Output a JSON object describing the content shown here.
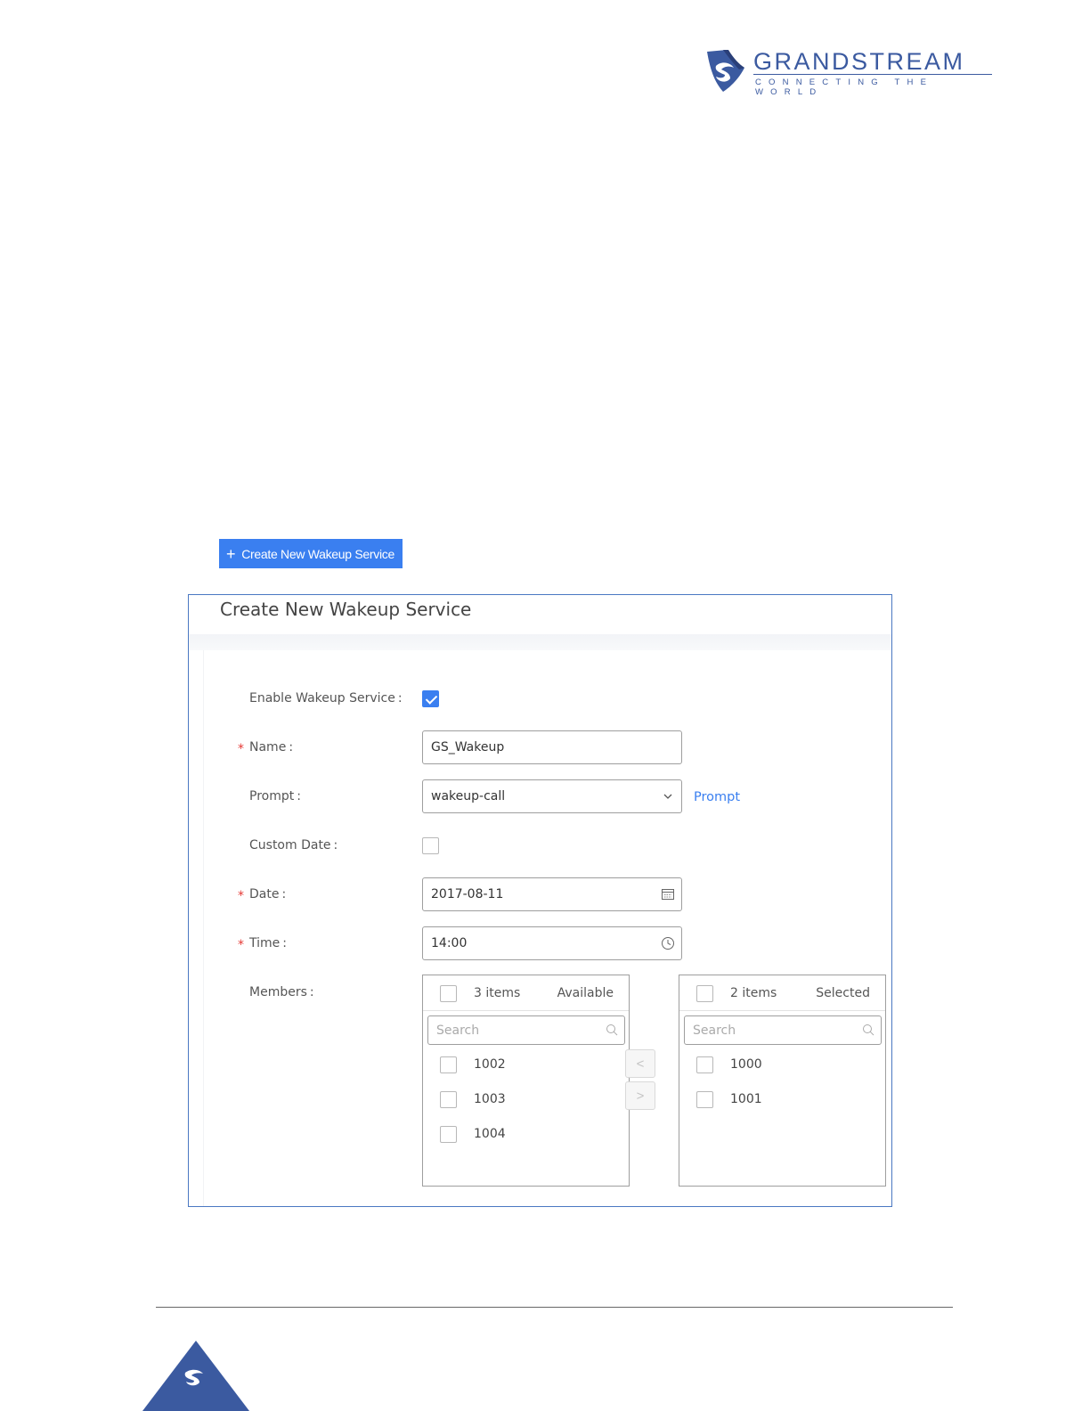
{
  "header": {
    "brand": "GRANDSTREAM",
    "tagline": "CONNECTING THE WORLD",
    "brand_color": "#3b5aa0"
  },
  "create_button": {
    "label": "Create New Wakeup Service",
    "icon": "plus-icon",
    "color": "#3a7ff0"
  },
  "dialog": {
    "title": "Create New Wakeup Service",
    "fields": {
      "enable": {
        "label": "Enable Wakeup Service",
        "checked": true
      },
      "name": {
        "label": "Name",
        "value": "GS_Wakeup",
        "required": true
      },
      "prompt": {
        "label": "Prompt",
        "value": "wakeup-call",
        "link": "Prompt",
        "icon": "chevron-down-icon"
      },
      "custom_date": {
        "label": "Custom Date",
        "checked": false
      },
      "date": {
        "label": "Date",
        "value": "2017-08-11",
        "required": true,
        "icon": "calendar-icon"
      },
      "time": {
        "label": "Time",
        "value": "14:00",
        "required": true,
        "icon": "clock-icon"
      },
      "members": {
        "label": "Members"
      }
    },
    "colon": ":",
    "required_mark": "*"
  },
  "members": {
    "available": {
      "count": "3 items",
      "title": "Available",
      "search_placeholder": "Search",
      "items": [
        "1002",
        "1003",
        "1004"
      ]
    },
    "selected": {
      "count": "2 items",
      "title": "Selected",
      "search_placeholder": "Search",
      "items": [
        "1000",
        "1001"
      ]
    },
    "move_left": "<",
    "move_right": ">"
  }
}
